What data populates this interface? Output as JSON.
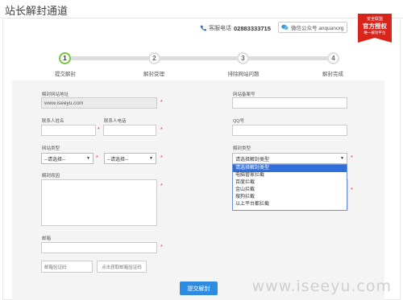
{
  "page": {
    "title": "站长解封通道"
  },
  "contact": {
    "hotline_label": "客服电话",
    "hotline_number": "02883333715",
    "wechat_label": "微信公众号 anquanorg"
  },
  "badge": {
    "line1": "安全联盟",
    "line2": "官方授权",
    "line3": "唯一解封平台"
  },
  "steps": [
    {
      "num": "1",
      "label": "提交解封"
    },
    {
      "num": "2",
      "label": "解封受理"
    },
    {
      "num": "3",
      "label": "排除网站问题"
    },
    {
      "num": "4",
      "label": "解封完成"
    }
  ],
  "form": {
    "site_url": {
      "label": "解封网站地址",
      "value": "www.iseeyu.com"
    },
    "icp": {
      "label": "网站备案号",
      "value": ""
    },
    "contact_name": {
      "label": "联系人姓名",
      "value": ""
    },
    "contact_phone": {
      "label": "联系人电话",
      "value": ""
    },
    "qq": {
      "label": "QQ号",
      "value": ""
    },
    "site_type": {
      "label": "网站类型",
      "select1": "--请选择--",
      "select2": "--请选择--"
    },
    "unblock_type": {
      "label": "解封类型",
      "selected": "请选择解封类型",
      "options": [
        "请选择解封类型",
        "电脑管家拦截",
        "百度拦截",
        "金山拦截",
        "搜狗拦截",
        "以上平台都拦截"
      ]
    },
    "reason": {
      "label": "解封原因",
      "value": ""
    },
    "email": {
      "label": "邮箱",
      "value": ""
    },
    "email_code": {
      "placeholder": "邮箱验证码"
    },
    "get_code_button": "点击获取邮箱验证码",
    "submit_button": "提交解封"
  },
  "watermark": "www.iseeyu.com"
}
